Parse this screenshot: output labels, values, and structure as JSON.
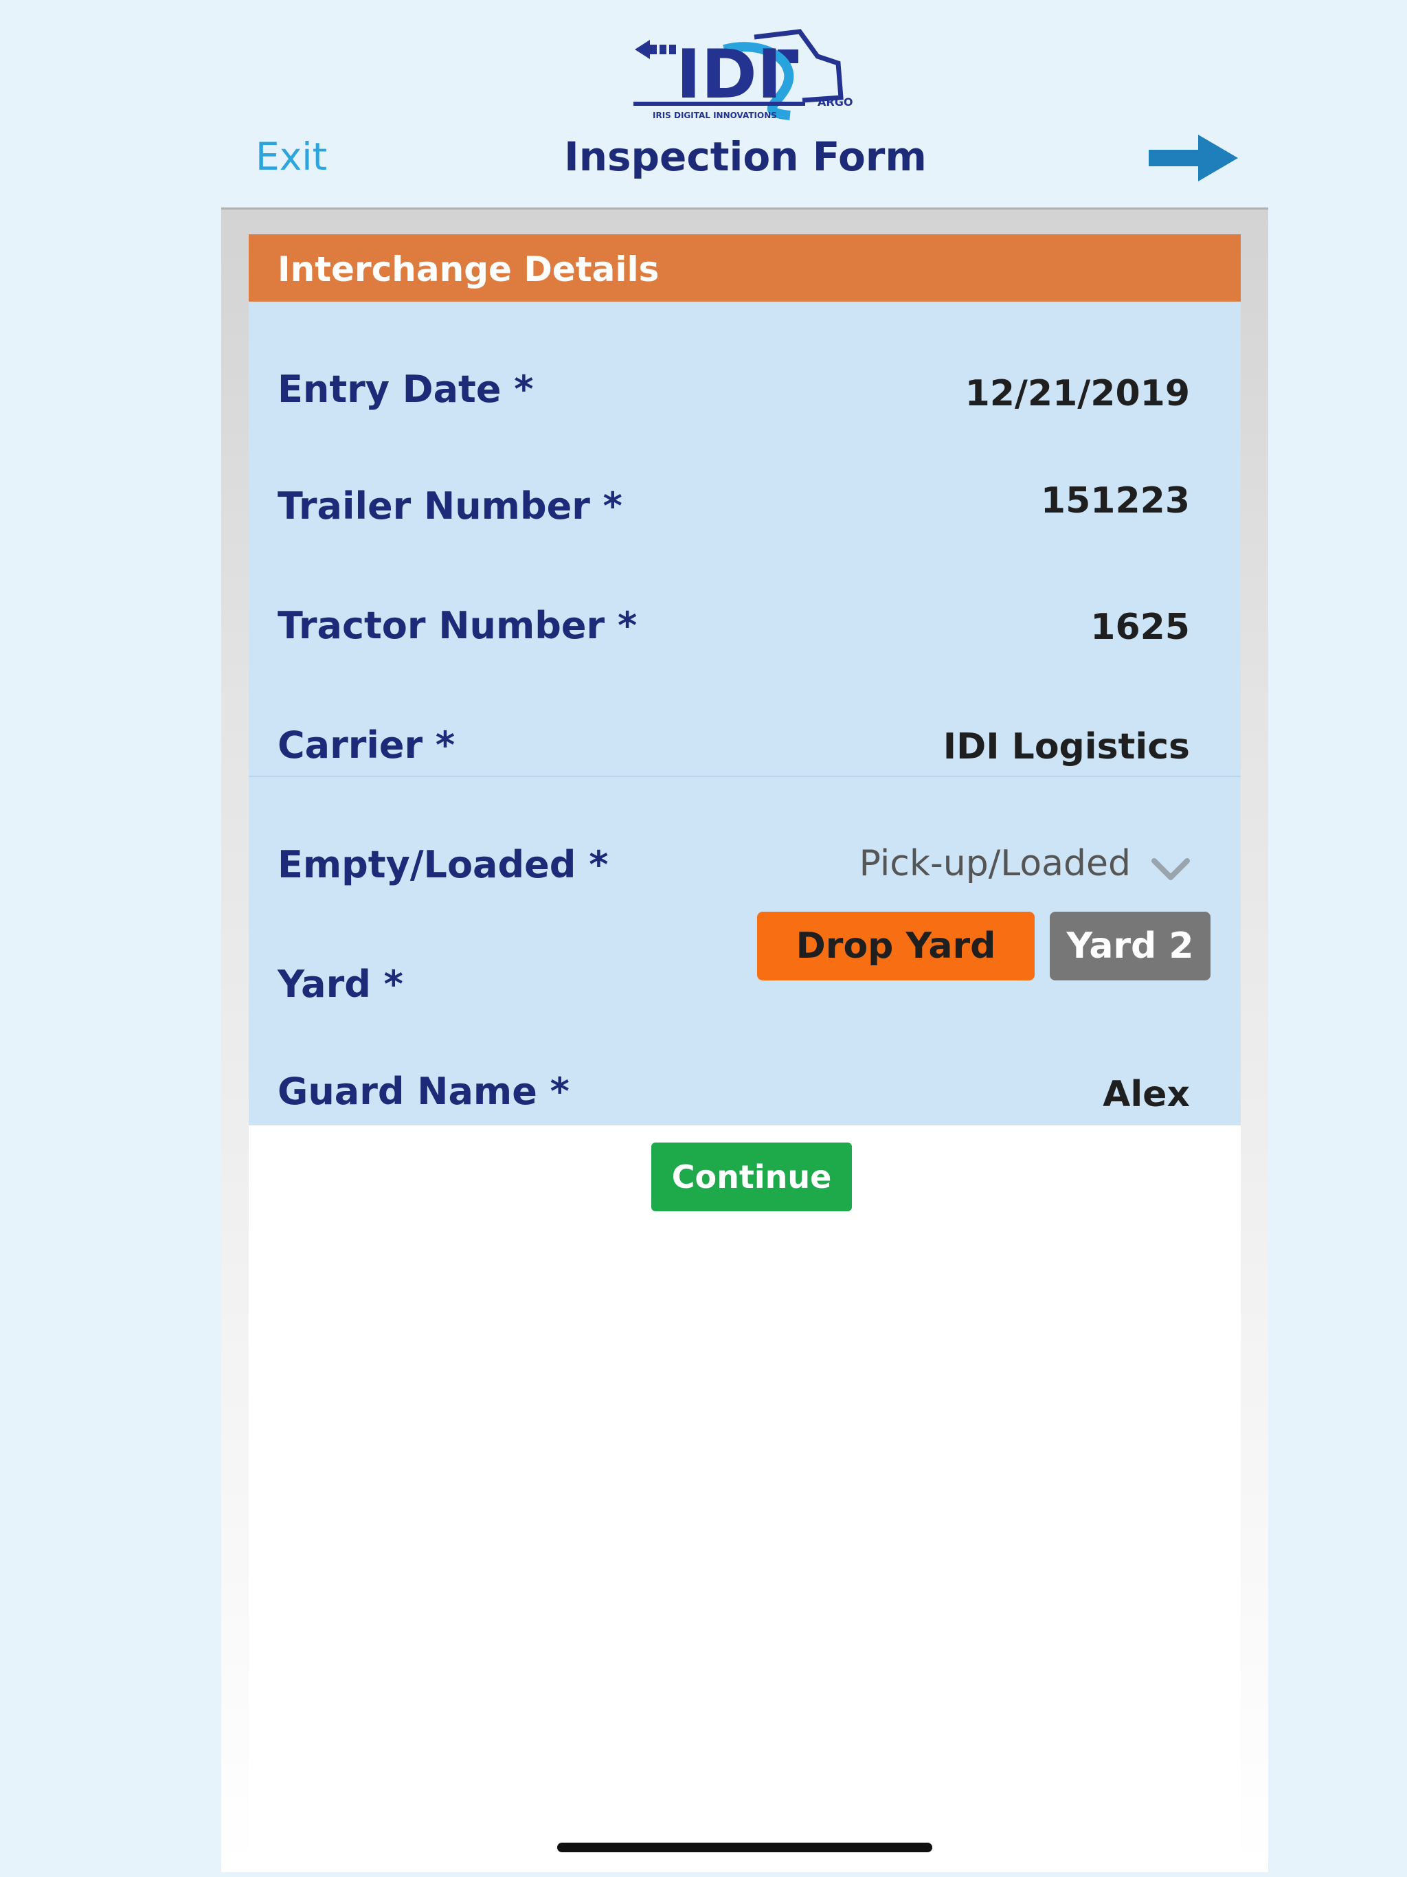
{
  "logo": {
    "brand": "IDI",
    "subtitle": "IRIS DIGITAL INNOVATIONS",
    "suffix": "ARGO"
  },
  "header": {
    "exit_label": "Exit",
    "title": "Inspection Form"
  },
  "section": {
    "title": "Interchange Details"
  },
  "fields": {
    "entry_date": {
      "label": "Entry Date *",
      "value": "12/21/2019"
    },
    "trailer_number": {
      "label": "Trailer Number *",
      "value": "151223"
    },
    "tractor_number": {
      "label": "Tractor Number *",
      "value": "1625"
    },
    "carrier": {
      "label": "Carrier *",
      "value": "IDI Logistics"
    },
    "empty_loaded": {
      "label": "Empty/Loaded *",
      "value": "Pick-up/Loaded"
    },
    "yard": {
      "label": "Yard *",
      "option_1": "Drop Yard",
      "option_2": "Yard 2",
      "selected": "Drop Yard"
    },
    "guard_name": {
      "label": "Guard Name *",
      "value": "Alex"
    }
  },
  "actions": {
    "continue_label": "Continue"
  },
  "colors": {
    "section_header": "#de7c3f",
    "form_background": "#cde4f7",
    "label_text": "#1c2a78",
    "exit_link": "#2ea4dd",
    "next_arrow": "#1f7fba",
    "drop_yard_selected": "#f86e12",
    "yard2_unselected": "#777777",
    "continue_button": "#1eaa4a"
  },
  "icons": {
    "next": "arrow-right-icon",
    "dropdown": "chevron-down-icon"
  }
}
